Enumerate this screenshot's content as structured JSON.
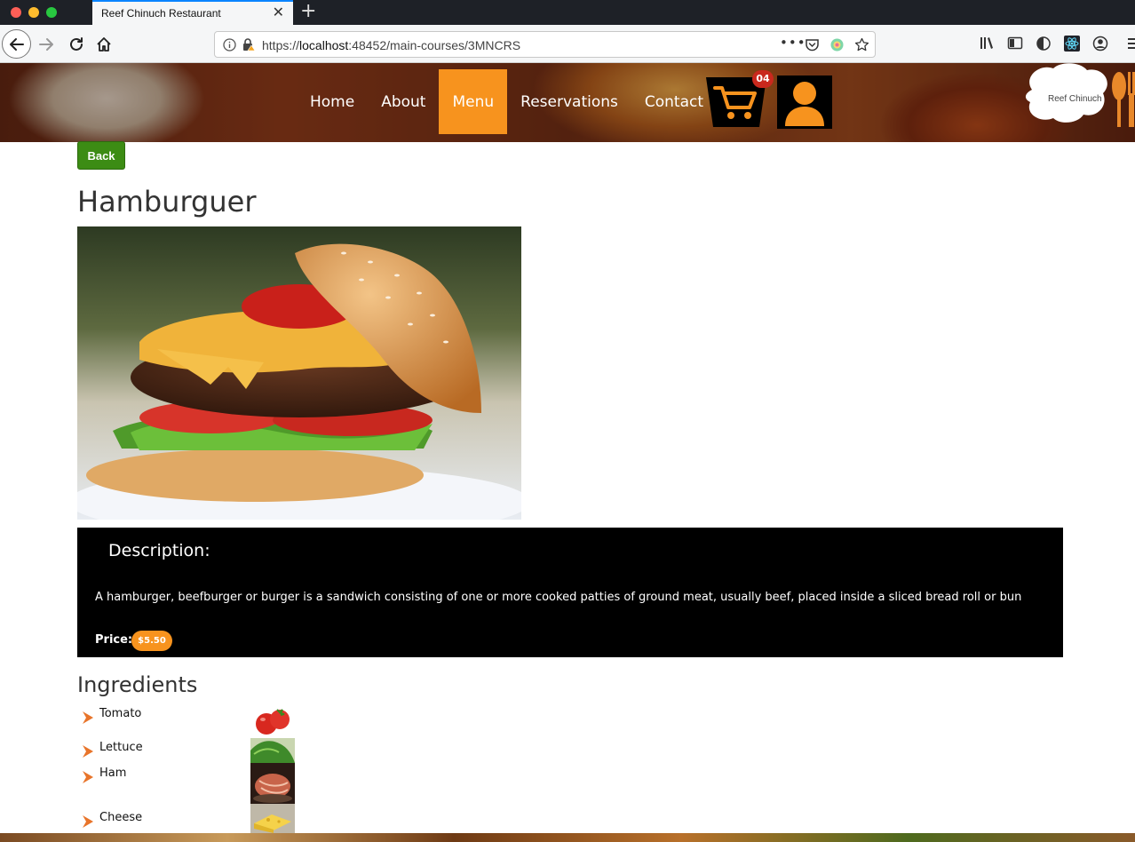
{
  "browser": {
    "tab_title": "Reef Chinuch Restaurant",
    "url_prefix": "https://",
    "url_host": "localhost",
    "url_path": ":48452/main-courses/3MNCRS"
  },
  "site": {
    "nav": [
      {
        "label": "Home",
        "active": false
      },
      {
        "label": "About",
        "active": false
      },
      {
        "label": "Menu",
        "active": true
      },
      {
        "label": "Reservations",
        "active": false
      },
      {
        "label": "Contact",
        "active": false
      }
    ],
    "cart_count": "04",
    "logo_text": "Reef Chinuch",
    "accent_color": "#f7931e",
    "back_button_color": "#3c8c14"
  },
  "page": {
    "back_label": "Back",
    "title": "Hamburguer",
    "description_heading": "Description:",
    "description": "A hamburger, beefburger or burger is a sandwich consisting of one or more cooked patties of ground meat, usually beef, placed inside a sliced bread roll or bun",
    "price_label": "Price:",
    "price": "$5.50",
    "ingredients_title": "Ingredients",
    "ingredients": [
      {
        "name": "Tomato"
      },
      {
        "name": "Lettuce"
      },
      {
        "name": "Ham"
      },
      {
        "name": "Cheese"
      }
    ]
  }
}
